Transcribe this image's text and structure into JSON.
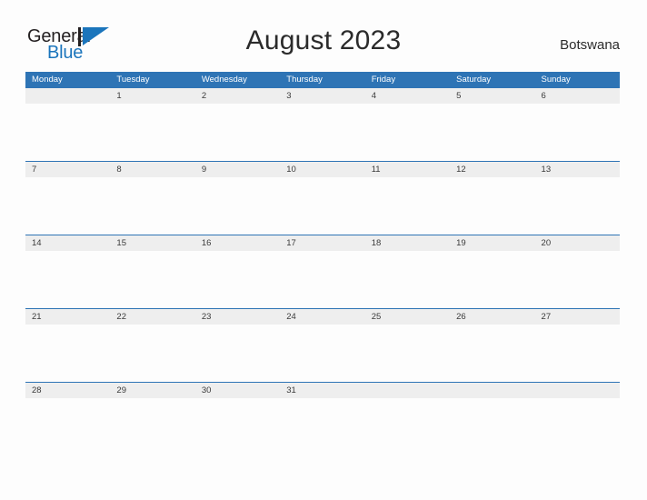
{
  "brand": {
    "name_part1": "General",
    "name_part2": "Blue",
    "flag_icon": "blue-triangle-flag-icon",
    "accent_color": "#1b75bc"
  },
  "header": {
    "title": "August 2023",
    "region": "Botswana"
  },
  "colors": {
    "header_blue": "#2e74b5",
    "band_gray": "#eeeeee",
    "page_background": "#fdfdfd",
    "text_dark": "#2b2b2b"
  },
  "calendar": {
    "month": "August",
    "year": "2023",
    "weekdays": [
      "Monday",
      "Tuesday",
      "Wednesday",
      "Thursday",
      "Friday",
      "Saturday",
      "Sunday"
    ],
    "weeks": [
      [
        "",
        "1",
        "2",
        "3",
        "4",
        "5",
        "6"
      ],
      [
        "7",
        "8",
        "9",
        "10",
        "11",
        "12",
        "13"
      ],
      [
        "14",
        "15",
        "16",
        "17",
        "18",
        "19",
        "20"
      ],
      [
        "21",
        "22",
        "23",
        "24",
        "25",
        "26",
        "27"
      ],
      [
        "28",
        "29",
        "30",
        "31",
        "",
        "",
        ""
      ]
    ]
  }
}
